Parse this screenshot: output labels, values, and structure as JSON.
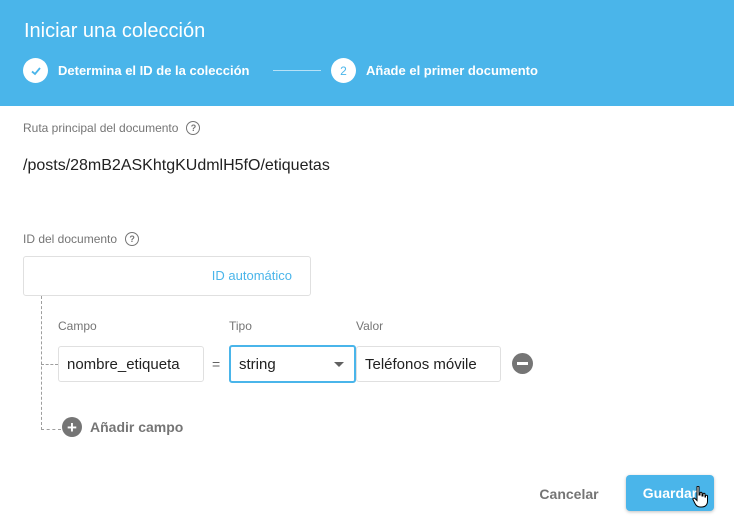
{
  "dialog": {
    "title": "Iniciar una colección",
    "steps": [
      {
        "number": "✓",
        "label": "Determina el ID de la colección",
        "state": "completed"
      },
      {
        "number": "2",
        "label": "Añade el primer documento",
        "state": "active"
      }
    ]
  },
  "path": {
    "label": "Ruta principal del documento",
    "value": "/posts/28mB2ASKhtgKUdmlH5fO/etiquetas"
  },
  "document_id": {
    "label": "ID del documento",
    "auto_button": "ID automático"
  },
  "fields": {
    "columns": {
      "field": "Campo",
      "type": "Tipo",
      "value": "Valor"
    },
    "row": {
      "field": "nombre_etiqueta",
      "equals": "=",
      "type": "string",
      "value": "Teléfonos móvile"
    },
    "add_label": "Añadir campo"
  },
  "actions": {
    "cancel": "Cancelar",
    "save": "Guardar"
  },
  "icons": {
    "help": "help-circle-icon",
    "remove": "minus-circle-icon",
    "add": "plus-circle-icon",
    "dropdown": "chevron-down-icon",
    "cursor": "hand-pointer-icon"
  },
  "colors": {
    "accent": "#4ab5ea",
    "text": "#212121",
    "muted": "#757575",
    "border": "#e0e0e0"
  }
}
